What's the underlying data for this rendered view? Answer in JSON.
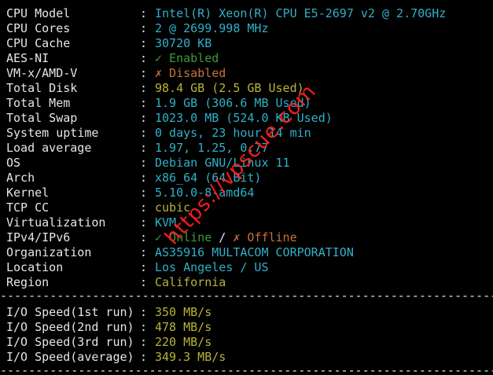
{
  "rows": [
    {
      "label": "CPU Model",
      "value": "Intel(R) Xeon(R) CPU E5-2697 v2 @ 2.70GHz",
      "color": "cyan"
    },
    {
      "label": "CPU Cores",
      "value": "2 @ 2699.998 MHz",
      "color": "cyan"
    },
    {
      "label": "CPU Cache",
      "value": "30720 KB",
      "color": "cyan"
    },
    {
      "label": "AES-NI",
      "value": "✓ Enabled",
      "color": "green"
    },
    {
      "label": "VM-x/AMD-V",
      "value": "✗ Disabled",
      "color": "red"
    },
    {
      "label": "Total Disk",
      "value": "98.4 GB (2.5 GB Used)",
      "color": "yellow"
    },
    {
      "label": "Total Mem",
      "value": "1.9 GB (306.6 MB Used)",
      "color": "cyan"
    },
    {
      "label": "Total Swap",
      "value": "1023.0 MB (524.0 KB Used)",
      "color": "cyan"
    },
    {
      "label": "System uptime",
      "value": "0 days, 23 hour 14 min",
      "color": "cyan"
    },
    {
      "label": "Load average",
      "value": "1.97, 1.25, 0.77",
      "color": "cyan"
    },
    {
      "label": "OS",
      "value": "Debian GNU/Linux 11",
      "color": "cyan"
    },
    {
      "label": "Arch",
      "value": "x86_64 (64 Bit)",
      "color": "cyan"
    },
    {
      "label": "Kernel",
      "value": "5.10.0-8-amd64",
      "color": "cyan"
    },
    {
      "label": "TCP CC",
      "value": "cubic",
      "color": "yellow"
    },
    {
      "label": "Virtualization",
      "value": "KVM",
      "color": "cyan"
    },
    {
      "label": "IPv4/IPv6",
      "value_parts": [
        "✓ Online",
        " / ",
        "✗ Offline"
      ],
      "color_parts": [
        "green",
        "white",
        "red"
      ]
    },
    {
      "label": "Organization",
      "value": "AS35916 MULTACOM CORPORATION",
      "color": "cyan"
    },
    {
      "label": "Location",
      "value": "Los Angeles / US",
      "color": "cyan"
    },
    {
      "label": "Region",
      "value": "California",
      "color": "yellow"
    }
  ],
  "separator": ":",
  "dash_line": "------------------------------------------------------------------------",
  "io": [
    {
      "label": "I/O Speed(1st run)",
      "value": "350 MB/s"
    },
    {
      "label": "I/O Speed(2nd run)",
      "value": "478 MB/s"
    },
    {
      "label": "I/O Speed(3rd run)",
      "value": "220 MB/s"
    },
    {
      "label": "I/O Speed(average)",
      "value": "349.3 MB/s"
    }
  ],
  "watermark": "https://vpscue.com",
  "colors": {
    "background": "#000000",
    "text": "#e6e6e6",
    "cyan": "#2fb0c8",
    "yellow": "#b8b23a",
    "green": "#3e9a3a",
    "red": "#c9703a",
    "watermark": "#ff1f1f"
  }
}
